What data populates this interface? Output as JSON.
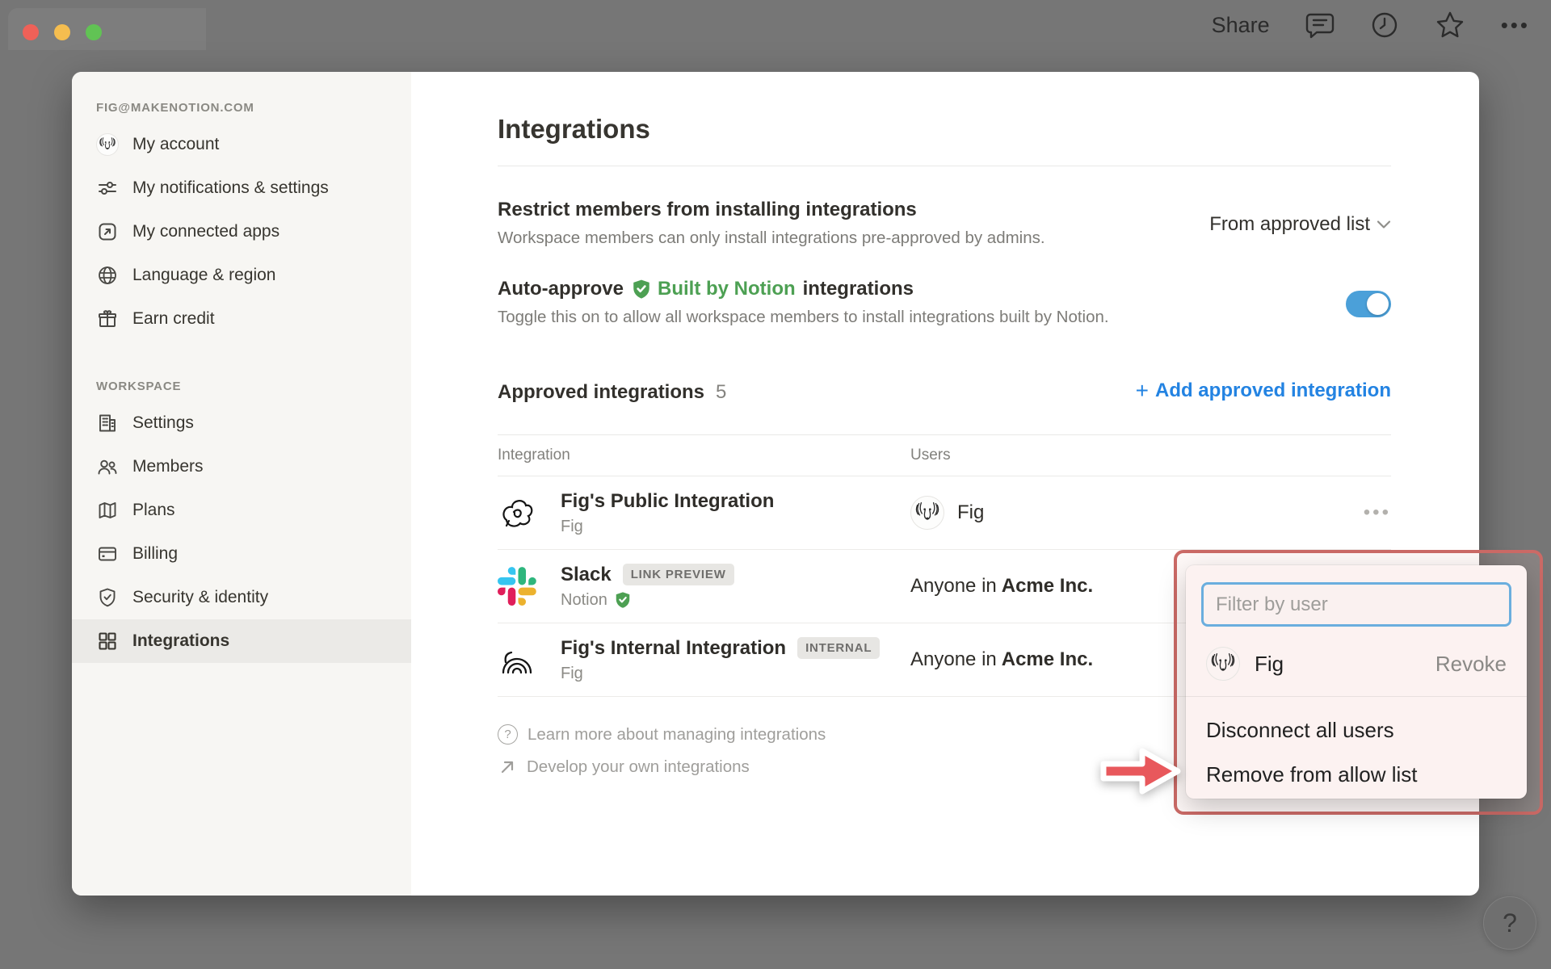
{
  "topbar": {
    "share_label": "Share",
    "icons": [
      "comment-icon",
      "clock-icon",
      "star-icon",
      "more-icon"
    ],
    "more_glyph": "•••"
  },
  "sidebar": {
    "account_header": "FIG@MAKENOTION.COM",
    "account_items": [
      {
        "label": "My account",
        "icon": "avatar-fig"
      },
      {
        "label": "My notifications & settings",
        "icon": "sliders-icon"
      },
      {
        "label": "My connected apps",
        "icon": "arrow-up-right-square-icon"
      },
      {
        "label": "Language & region",
        "icon": "globe-icon"
      },
      {
        "label": "Earn credit",
        "icon": "gift-icon"
      }
    ],
    "workspace_header": "WORKSPACE",
    "workspace_items": [
      {
        "label": "Settings",
        "icon": "building-icon"
      },
      {
        "label": "Members",
        "icon": "people-icon"
      },
      {
        "label": "Plans",
        "icon": "map-icon"
      },
      {
        "label": "Billing",
        "icon": "credit-card-icon"
      },
      {
        "label": "Security & identity",
        "icon": "shield-check-icon"
      },
      {
        "label": "Integrations",
        "icon": "grid-icon",
        "active": true
      }
    ]
  },
  "main": {
    "title": "Integrations",
    "restrict": {
      "title": "Restrict members from installing integrations",
      "description": "Workspace members can only install integrations pre-approved by admins.",
      "dropdown_value": "From approved list"
    },
    "auto_approve": {
      "title_prefix": "Auto-approve",
      "badge_label": "Built by Notion",
      "title_suffix": "integrations",
      "description": "Toggle this on to allow all workspace members to install integrations built by Notion.",
      "toggle_state": "on"
    },
    "approved": {
      "title": "Approved integrations",
      "count": "5",
      "add_label": "Add approved integration"
    },
    "table": {
      "col_integration": "Integration",
      "col_users": "Users",
      "rows": [
        {
          "name": "Fig's Public Integration",
          "badge": "",
          "owner": "Fig",
          "icon": "scribble-doodle",
          "users_name": "Fig",
          "menu_glyph": "•••"
        },
        {
          "name": "Slack",
          "badge": "LINK PREVIEW",
          "owner": "Notion",
          "verified": true,
          "icon": "slack-logo",
          "users_prefix": "Anyone in",
          "users_bold": "Acme Inc."
        },
        {
          "name": "Fig's Internal Integration",
          "badge": "INTERNAL",
          "owner": "Fig",
          "icon": "arches-doodle",
          "users_prefix": "Anyone in",
          "users_bold": "Acme Inc."
        }
      ]
    },
    "footer_links": [
      {
        "label": "Learn more about managing integrations",
        "icon": "question-circle-icon",
        "glyph": "?"
      },
      {
        "label": "Develop your own integrations",
        "icon": "arrow-up-right-icon"
      }
    ]
  },
  "popup": {
    "filter_placeholder": "Filter by user",
    "user_row": {
      "name": "Fig",
      "action": "Revoke"
    },
    "menu_items": [
      "Disconnect all users",
      "Remove from allow list"
    ]
  },
  "help_button": "?",
  "colors": {
    "accent_blue": "#2383e2",
    "toggle_blue": "#4ba0d9",
    "verified_green": "#4da053",
    "annotation_red": "#cb6a66",
    "arrow_red": "#e8585c",
    "sidebar_bg": "#f7f6f3",
    "backdrop_gray": "#767676",
    "slack_brand": [
      "#36C5F0",
      "#2EB67D",
      "#ECB22E",
      "#E01E5A"
    ]
  }
}
